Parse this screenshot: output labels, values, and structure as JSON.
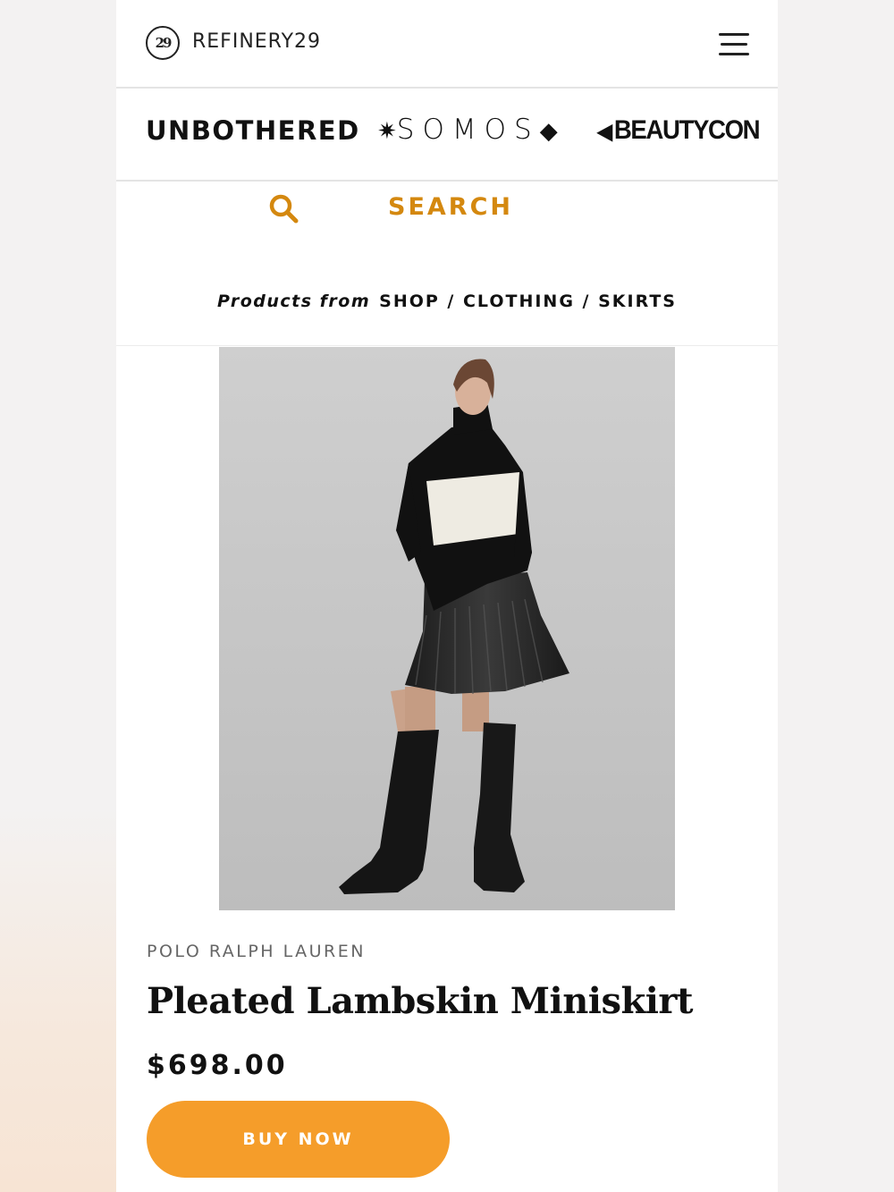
{
  "header": {
    "logo_mark": "29",
    "logo_text": "REFINERY29",
    "menu_icon": "hamburger-menu-icon"
  },
  "brands": {
    "unbothered": "UNBOTHERED",
    "somos_left_glyph": "✷",
    "somos": "SOMOS",
    "somos_right_glyph": "◆",
    "beautycon_glyph": "◀",
    "beautycon": "BEAUTYCON"
  },
  "search": {
    "icon": "search-icon",
    "label": "SEARCH",
    "accent_color": "#d4880f"
  },
  "breadcrumb": {
    "prefix": "Products from",
    "path": "SHOP / CLOTHING / SKIRTS"
  },
  "product": {
    "brand": "POLO RALPH LAUREN",
    "title": "Pleated Lambskin Miniskirt",
    "price": "$698.00",
    "buy_label": "BUY NOW",
    "button_color": "#f59d2a"
  }
}
